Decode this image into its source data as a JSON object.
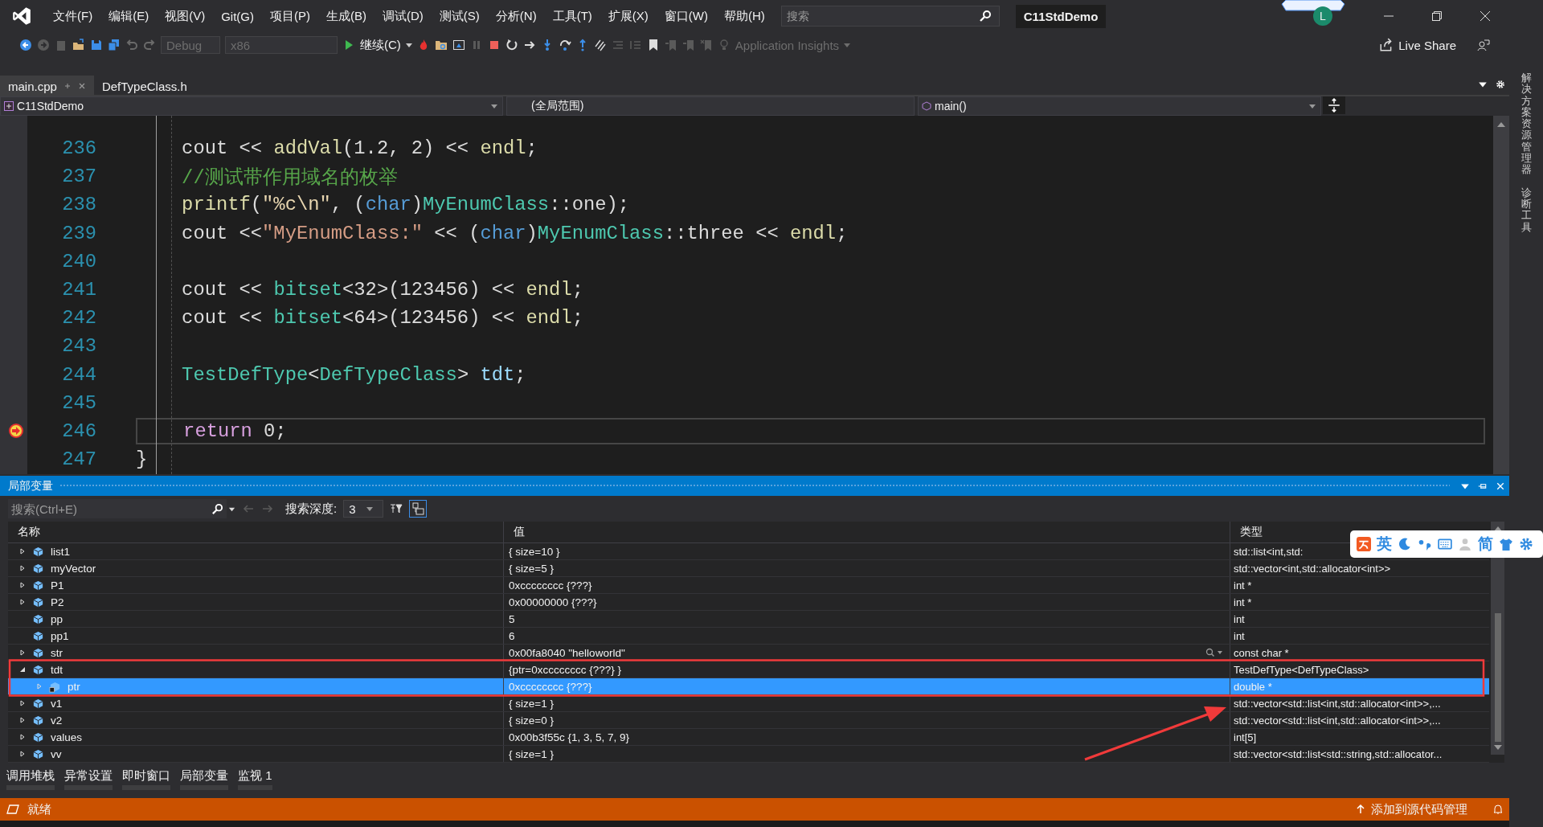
{
  "menu": [
    "文件(F)",
    "编辑(E)",
    "视图(V)",
    "Git(G)",
    "项目(P)",
    "生成(B)",
    "调试(D)",
    "测试(S)",
    "分析(N)",
    "工具(T)",
    "扩展(X)",
    "窗口(W)",
    "帮助(H)"
  ],
  "search": {
    "placeholder": "搜索"
  },
  "title": "C11StdDemo",
  "avatar": "L",
  "toolbar": {
    "configuration": "Debug",
    "platform": "x86",
    "continue": "继续(C)",
    "insights": "Application Insights",
    "live_share": "Live Share"
  },
  "tabs": [
    {
      "label": "main.cpp",
      "selected": true
    },
    {
      "label": "DefTypeClass.h",
      "selected": false
    }
  ],
  "nav": {
    "project": "C11StdDemo",
    "scope": "(全局范围)",
    "member": "main()"
  },
  "code": [
    {
      "number": "236",
      "current": false,
      "tokens": [
        {
          "kind": "plain",
          "text": "    cout << "
        },
        {
          "kind": "func",
          "text": "addVal"
        },
        {
          "kind": "plain",
          "text": "(1.2, 2) << "
        },
        {
          "kind": "func",
          "text": "endl"
        },
        {
          "kind": "plain",
          "text": ";"
        }
      ]
    },
    {
      "number": "237",
      "current": false,
      "tokens": [
        {
          "kind": "comment",
          "text": "    //测试带作用域名的枚举"
        }
      ]
    },
    {
      "number": "238",
      "current": false,
      "tokens": [
        {
          "kind": "func",
          "text": "    printf"
        },
        {
          "kind": "plain",
          "text": "("
        },
        {
          "kind": "format",
          "text": "\"%c\\n\""
        },
        {
          "kind": "plain",
          "text": ", ("
        },
        {
          "kind": "keyword",
          "text": "char"
        },
        {
          "kind": "plain",
          "text": ")"
        },
        {
          "kind": "type",
          "text": "MyEnumClass"
        },
        {
          "kind": "plain",
          "text": "::one);"
        }
      ]
    },
    {
      "number": "239",
      "current": false,
      "tokens": [
        {
          "kind": "plain",
          "text": "    cout <<"
        },
        {
          "kind": "string",
          "text": "\"MyEnumClass:\""
        },
        {
          "kind": "plain",
          "text": " << ("
        },
        {
          "kind": "keyword",
          "text": "char"
        },
        {
          "kind": "plain",
          "text": ")"
        },
        {
          "kind": "type",
          "text": "MyEnumClass"
        },
        {
          "kind": "plain",
          "text": "::three << "
        },
        {
          "kind": "func",
          "text": "endl"
        },
        {
          "kind": "plain",
          "text": ";"
        }
      ]
    },
    {
      "number": "240",
      "current": false
    },
    {
      "number": "241",
      "current": false,
      "tokens": [
        {
          "kind": "plain",
          "text": "    cout << "
        },
        {
          "kind": "type",
          "text": "bitset"
        },
        {
          "kind": "plain",
          "text": "<32>(123456) << "
        },
        {
          "kind": "func",
          "text": "endl"
        },
        {
          "kind": "plain",
          "text": ";"
        }
      ]
    },
    {
      "number": "242",
      "current": false,
      "tokens": [
        {
          "kind": "plain",
          "text": "    cout << "
        },
        {
          "kind": "type",
          "text": "bitset"
        },
        {
          "kind": "plain",
          "text": "<64>(123456) << "
        },
        {
          "kind": "func",
          "text": "endl"
        },
        {
          "kind": "plain",
          "text": ";"
        }
      ]
    },
    {
      "number": "243",
      "current": false
    },
    {
      "number": "244",
      "current": false,
      "tokens": [
        {
          "kind": "type",
          "text": "    TestDefType"
        },
        {
          "kind": "plain",
          "text": "<"
        },
        {
          "kind": "type",
          "text": "DefTypeClass"
        },
        {
          "kind": "plain",
          "text": "> "
        },
        {
          "kind": "variable",
          "text": "tdt"
        },
        {
          "kind": "plain",
          "text": ";"
        }
      ]
    },
    {
      "number": "245",
      "current": false
    },
    {
      "number": "246",
      "current": true,
      "tokens": [
        {
          "kind": "control",
          "text": "    return"
        },
        {
          "kind": "plain",
          "text": " 0;"
        }
      ]
    },
    {
      "number": "247",
      "current": false,
      "tokens": [
        {
          "kind": "plain",
          "text": "}"
        }
      ]
    }
  ],
  "locals": {
    "title": "局部变量",
    "search_placeholder": "搜索(Ctrl+E)",
    "depth_label": "搜索深度:",
    "depth": "3",
    "columns": [
      "名称",
      "值",
      "类型"
    ],
    "rows": [
      {
        "name": "list1",
        "value": "{ size=10 }",
        "type": "std::list<int,std:",
        "expandable": true,
        "expanded": false,
        "selected": false,
        "visualizer": false
      },
      {
        "name": "myVector",
        "value": "{ size=5 }",
        "type": "std::vector<int,std::allocator<int>>",
        "expandable": true,
        "expanded": false,
        "selected": false,
        "visualizer": false
      },
      {
        "name": "P1",
        "value": "0xcccccccc {???}",
        "type": "int *",
        "expandable": true,
        "expanded": false,
        "selected": false,
        "visualizer": false
      },
      {
        "name": "P2",
        "value": "0x00000000 {???}",
        "type": "int *",
        "expandable": true,
        "expanded": false,
        "selected": false,
        "visualizer": false
      },
      {
        "name": "pp",
        "value": "5",
        "type": "int",
        "expandable": false,
        "selected": false,
        "visualizer": false
      },
      {
        "name": "pp1",
        "value": "6",
        "type": "int",
        "expandable": false,
        "selected": false,
        "visualizer": false
      },
      {
        "name": "str",
        "value": "0x00fa8040 \"helloworld\"",
        "type": "const char *",
        "expandable": true,
        "expanded": false,
        "selected": false,
        "visualizer": true
      },
      {
        "name": "tdt",
        "value": "{ptr=0xcccccccc {???} }",
        "type": "TestDefType<DefTypeClass>",
        "expandable": true,
        "expanded": true,
        "selected": false,
        "visualizer": false,
        "children": [
          {
            "name": "ptr",
            "value": "0xcccccccc {???}",
            "type": "double *",
            "expandable": true,
            "expanded": false,
            "selected": true,
            "visualizer": false,
            "private": true
          }
        ]
      },
      {
        "name": "v1",
        "value": "{ size=1 }",
        "type": "std::vector<std::list<int,std::allocator<int>>,...",
        "expandable": true,
        "expanded": false,
        "selected": false,
        "visualizer": false
      },
      {
        "name": "v2",
        "value": "{ size=0 }",
        "type": "std::vector<std::list<int,std::allocator<int>>,...",
        "expandable": true,
        "expanded": false,
        "selected": false,
        "visualizer": false
      },
      {
        "name": "values",
        "value": "0x00b3f55c {1, 3, 5, 7, 9}",
        "type": "int[5]",
        "expandable": true,
        "expanded": false,
        "selected": false,
        "visualizer": false
      },
      {
        "name": "vv",
        "value": "{ size=1 }",
        "type": "std::vector<std::list<std::string,std::allocator...",
        "expandable": true,
        "expanded": false,
        "selected": false,
        "visualizer": false
      }
    ]
  },
  "bottom_tabs": [
    "调用堆栈",
    "异常设置",
    "即时窗口",
    "局部变量",
    "监视 1"
  ],
  "status": {
    "text": "就绪",
    "source_control": "添加到源代码管理"
  },
  "side_tabs": [
    "解决方案资源管理器",
    "诊断工具"
  ],
  "ime": {
    "language": "英",
    "script": "简"
  }
}
